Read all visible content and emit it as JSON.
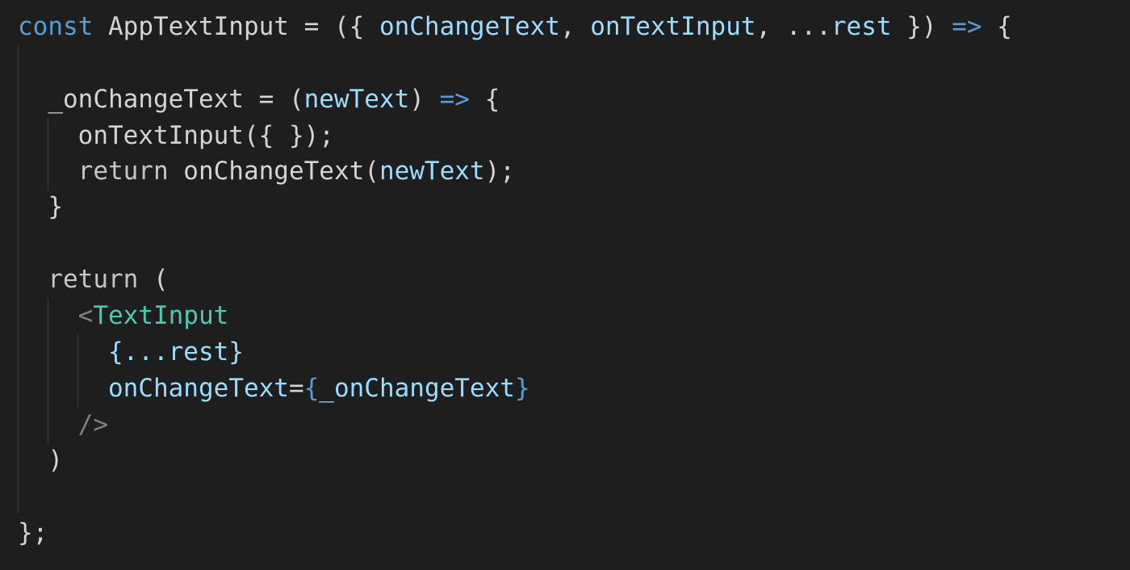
{
  "colors": {
    "background": "#1e1e1e",
    "plain": "#d4d4d4",
    "keyword": "#569cd6",
    "parameter": "#9cdcfe",
    "jsx_tag": "#4ec9b0",
    "punctuation": "#808080",
    "indent_guide": "#404040"
  },
  "code": {
    "lines": [
      {
        "indent": "",
        "tokens": [
          {
            "text": "const",
            "kind": "keyword"
          },
          {
            "text": " AppTextInput = ({ ",
            "kind": "plain"
          },
          {
            "text": "onChangeText",
            "kind": "param"
          },
          {
            "text": ", ",
            "kind": "plain"
          },
          {
            "text": "onTextInput",
            "kind": "param"
          },
          {
            "text": ", ...",
            "kind": "plain"
          },
          {
            "text": "rest",
            "kind": "param"
          },
          {
            "text": " }) ",
            "kind": "plain"
          },
          {
            "text": "=>",
            "kind": "keyword"
          },
          {
            "text": " {",
            "kind": "plain"
          }
        ]
      },
      {
        "indent": "",
        "tokens": []
      },
      {
        "indent": "  ",
        "tokens": [
          {
            "text": "_onChangeText = (",
            "kind": "plain"
          },
          {
            "text": "newText",
            "kind": "param"
          },
          {
            "text": ") ",
            "kind": "plain"
          },
          {
            "text": "=>",
            "kind": "keyword"
          },
          {
            "text": " {",
            "kind": "plain"
          }
        ]
      },
      {
        "indent": "    ",
        "tokens": [
          {
            "text": "onTextInput({ });",
            "kind": "plain"
          }
        ]
      },
      {
        "indent": "    ",
        "tokens": [
          {
            "text": "return",
            "kind": "ret"
          },
          {
            "text": " onChangeText(",
            "kind": "plain"
          },
          {
            "text": "newText",
            "kind": "param"
          },
          {
            "text": ");",
            "kind": "plain"
          }
        ]
      },
      {
        "indent": "  ",
        "tokens": [
          {
            "text": "}",
            "kind": "plain"
          }
        ]
      },
      {
        "indent": "",
        "tokens": []
      },
      {
        "indent": "  ",
        "tokens": [
          {
            "text": "return",
            "kind": "ret"
          },
          {
            "text": " (",
            "kind": "plain"
          }
        ]
      },
      {
        "indent": "    ",
        "tokens": [
          {
            "text": "<",
            "kind": "punct"
          },
          {
            "text": "TextInput",
            "kind": "tag"
          }
        ]
      },
      {
        "indent": "      ",
        "tokens": [
          {
            "text": "{...",
            "kind": "param"
          },
          {
            "text": "rest",
            "kind": "param"
          },
          {
            "text": "}",
            "kind": "param"
          }
        ]
      },
      {
        "indent": "      ",
        "tokens": [
          {
            "text": "onChangeText",
            "kind": "param"
          },
          {
            "text": "=",
            "kind": "plain"
          },
          {
            "text": "{",
            "kind": "keyword"
          },
          {
            "text": "_onChangeText",
            "kind": "param"
          },
          {
            "text": "}",
            "kind": "keyword"
          }
        ]
      },
      {
        "indent": "    ",
        "tokens": [
          {
            "text": "/>",
            "kind": "punct"
          }
        ]
      },
      {
        "indent": "  ",
        "tokens": [
          {
            "text": ")",
            "kind": "plain"
          }
        ]
      },
      {
        "indent": "",
        "tokens": []
      },
      {
        "indent": "",
        "tokens": [
          {
            "text": "};",
            "kind": "plain"
          }
        ]
      }
    ]
  }
}
